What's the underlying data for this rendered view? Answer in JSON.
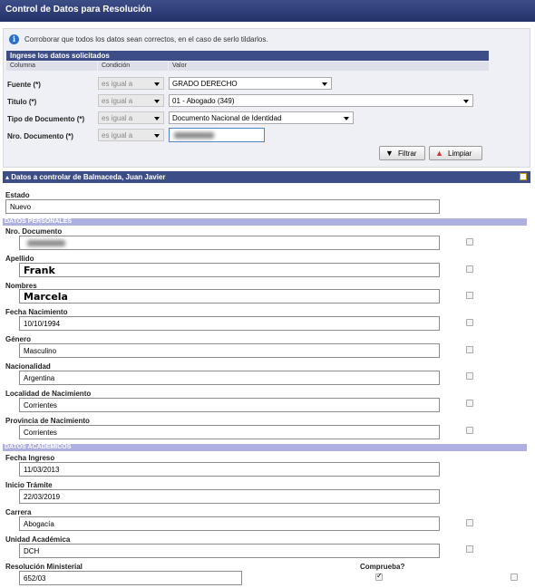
{
  "window": {
    "title": "Control de Datos para Resolución"
  },
  "info": {
    "icon": "info-icon",
    "text": "Corroborar que todos los datos sean correctos, en el caso de serlo tildarlos."
  },
  "filter": {
    "header": "Ingrese los datos solicitados",
    "columns": [
      "Columna",
      "Condición",
      "Valor"
    ],
    "rows": [
      {
        "label": "Fuente (*)",
        "condition": "es igual a",
        "value": "GRADO DERECHO"
      },
      {
        "label": "Titulo (*)",
        "condition": "es igual a",
        "value": "01 - Abogado (349)"
      },
      {
        "label": "Tipo de Documento (*)",
        "condition": "es igual a",
        "value": "Documento Nacional de Identidad"
      },
      {
        "label": "Nro. Documento (*)",
        "condition": "es igual a",
        "value": ""
      }
    ],
    "filter_button": "Filtrar",
    "clear_button": "Limpiar"
  },
  "section": {
    "title": "Datos a controlar de Balmaceda, Juan Javier",
    "estado_label": "Estado",
    "estado_value": "Nuevo",
    "personal_header": "DATOS PERSONALES",
    "personal": [
      {
        "label": "Nro. Documento",
        "value": ""
      },
      {
        "label": "Apellido",
        "value": "Frank"
      },
      {
        "label": "Nombres",
        "value": "Marcela"
      },
      {
        "label": "Fecha Nacimiento",
        "value": "10/10/1994"
      },
      {
        "label": "Género",
        "value": "Masculino"
      },
      {
        "label": "Nacionalidad",
        "value": "Argentina"
      },
      {
        "label": "Localidad de Nacimiento",
        "value": "Corrientes"
      },
      {
        "label": "Provincia de Nacimiento",
        "value": "Corrientes"
      }
    ],
    "academic_header": "DATOS ACADEMICOS",
    "academic": [
      {
        "label": "Fecha Ingreso",
        "value": "11/03/2013"
      },
      {
        "label": "Inicio Trámite",
        "value": "22/03/2019"
      },
      {
        "label": "Carrera",
        "value": "Abogacía"
      },
      {
        "label": "Unidad Académica",
        "value": "DCH"
      },
      {
        "label": "Resolución Ministerial",
        "value": "652/03"
      }
    ],
    "comprueba_label": "Comprueba?"
  }
}
